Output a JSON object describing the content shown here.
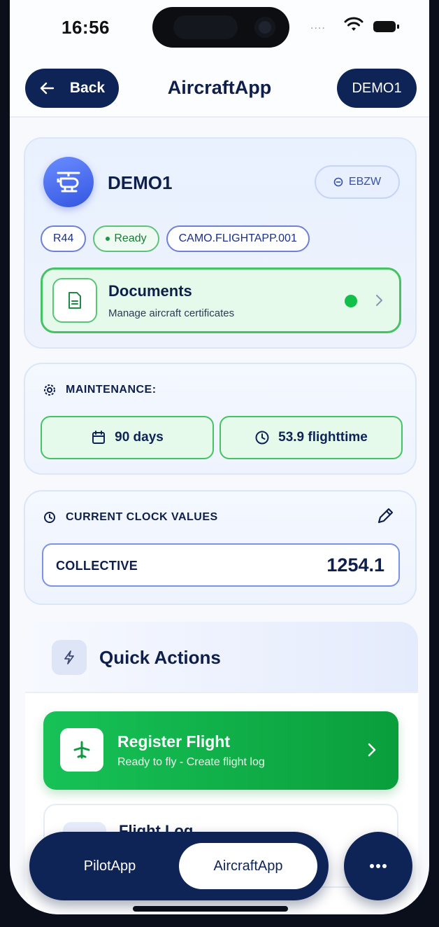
{
  "status_bar": {
    "time": "16:56",
    "signal": "....",
    "wifi_icon": "wifi-icon",
    "battery_icon": "battery-icon"
  },
  "header": {
    "back_label": "Back",
    "title": "AircraftApp",
    "registration_button": "DEMO1"
  },
  "aircraft": {
    "name": "DEMO1",
    "registration": "EBZW",
    "chips": [
      "R44",
      "Ready",
      "CAMO.FLIGHTAPP.001"
    ],
    "status_color": "#10c04a"
  },
  "documents": {
    "title": "Documents",
    "subtitle": "Manage aircraft certificates"
  },
  "maintenance": {
    "label": "MAINTENANCE:",
    "days": "90 days",
    "flighttime": "53.9 flighttime"
  },
  "clock": {
    "label": "CURRENT CLOCK VALUES",
    "row_label": "COLLECTIVE",
    "row_value": "1254.1"
  },
  "quick_actions": {
    "title": "Quick Actions",
    "register_title": "Register Flight",
    "register_subtitle": "Ready to fly - Create flight log",
    "next_title": "Flight Log"
  },
  "bottom_nav": {
    "tabs": [
      "PilotApp",
      "AircraftApp"
    ],
    "active": "AircraftApp"
  },
  "colors": {
    "navy": "#0f2456",
    "green": "#10c04a",
    "accent_blue": "#3355e0"
  }
}
